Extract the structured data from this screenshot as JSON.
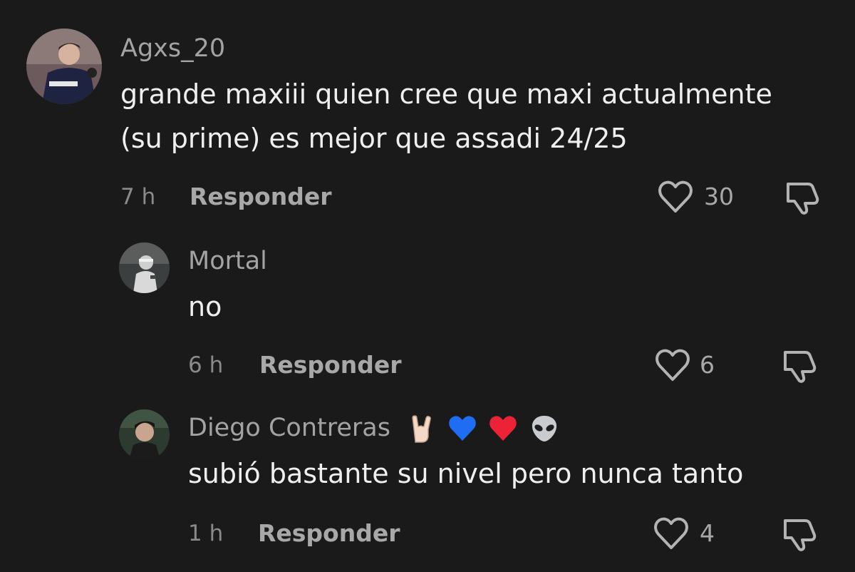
{
  "comments": [
    {
      "username": "Agxs_20",
      "text_lines": [
        "grande maxiii quien cree que maxi actualmente",
        "(su prime) es mejor que assadi 24/25"
      ],
      "time": "7 h",
      "reply_label": "Responder",
      "likes": "30",
      "avatar_icon": "avatar-photo"
    },
    {
      "username": "Mortal",
      "text_lines": [
        "no"
      ],
      "time": "6 h",
      "reply_label": "Responder",
      "likes": "6",
      "avatar_icon": "avatar-photo"
    },
    {
      "username": "Diego Contreras",
      "name_emojis": [
        "rock-hand-emoji",
        "blue-heart-emoji",
        "red-heart-emoji",
        "alien-emoji"
      ],
      "text_lines": [
        "subió bastante su nivel pero nunca tanto"
      ],
      "time": "1 h",
      "reply_label": "Responder",
      "likes": "4",
      "avatar_icon": "avatar-photo"
    }
  ],
  "icons": {
    "like": "heart-outline-icon",
    "dislike": "thumbs-down-outline-icon"
  },
  "colors": {
    "background": "#1a1a1a",
    "text": "#efefef",
    "secondary": "#a3a3a3"
  }
}
